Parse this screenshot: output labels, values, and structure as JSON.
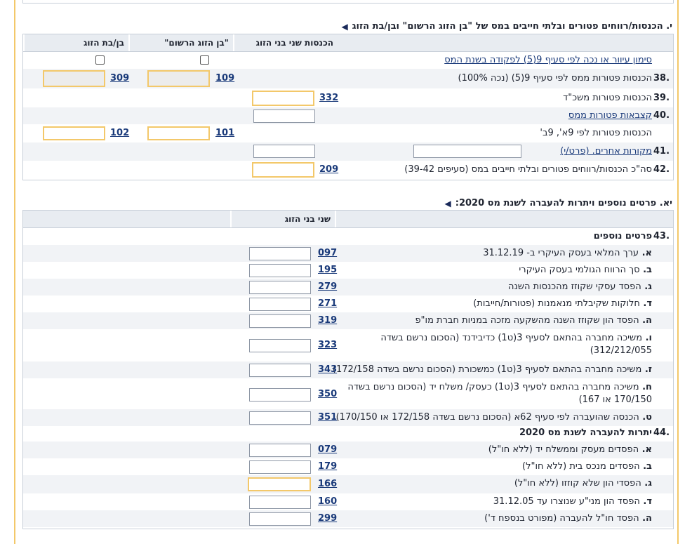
{
  "section10": {
    "title": "י. הכנסות/רווחים פטורים ובלתי חייבים במס של \"בן הזוג הרשום\" ובן/בת הזוג",
    "headers": {
      "both": "הכנסות שני בני הזוג",
      "registered": "\"בן הזוג הרשום\"",
      "spouse": "בן/בת הזוג"
    },
    "mark_row_label": "סימון עיוור או נכה לפי סעיף 9(5) לפקודה בשנת המס",
    "rows": {
      "r38": {
        "num": "38.",
        "label": "הכנסות פטורות ממס לפי סעיף 9(5) (נכה 100%)",
        "code_reg": "109",
        "code_sp": "309"
      },
      "r39": {
        "num": "39.",
        "label": "הכנסות פטורות משכ\"ד",
        "code": "332"
      },
      "r40": {
        "num": "40.",
        "label": "קצבאות פטורות ממס"
      },
      "r40b": {
        "label": "הכנסות פטורות לפי 9א', 9ב'",
        "code_reg": "101",
        "code_sp": "102"
      },
      "r41": {
        "num": "41.",
        "label": "מקורות אחרים. (פרט/י)"
      },
      "r42": {
        "num": "42.",
        "label": "סה\"כ הכנסות/רווחים פטורים ובלתי חייבים במס (סעיפים 39-42)",
        "code": "209"
      }
    }
  },
  "section11": {
    "title": "יא. פרטים נוספים ויתרות להעברה לשנת מס 2020:",
    "header": "שני בני הזוג",
    "r43": {
      "num": "43.",
      "label": "פרטים נוספים"
    },
    "items43": [
      {
        "letter": "א.",
        "label": "ערך המלאי בעסק העיקרי ב- 31.12.19",
        "code": "097"
      },
      {
        "letter": "ב.",
        "label": "סך הרווח הגולמי בעסק העיקרי",
        "code": "195"
      },
      {
        "letter": "ג.",
        "label": "הפסד עסקי שקוזז מהכנסות השנה",
        "code": "279"
      },
      {
        "letter": "ד.",
        "label": "חלוקות שקיבלתי מנאמנות (פטורות/חייבות)",
        "code": "271"
      },
      {
        "letter": "ה.",
        "label": "הפסד הון שקוזז השנה מהשקעה מזכה במניות חברת מו\"פ",
        "code": "319"
      },
      {
        "letter": "ו.",
        "label": "משיכה מחברה בהתאם לסעיף 3(ט1) כדיבידנד (הסכום נרשם בשדה 312/212/055)",
        "code": "323"
      },
      {
        "letter": "ז.",
        "label": "משיכה מחברה בהתאם לסעיף 3(ט1) כמשכורת (הסכום נרשם בשדה 172/158)",
        "code": "343"
      },
      {
        "letter": "ח.",
        "label": "משיכה מחברה בהתאם לסעיף 3(ט1) כעסק/ משלח יד (הסכום נרשם בשדה 170/150 או 167)",
        "code": "350"
      },
      {
        "letter": "ט.",
        "label": "הכנסה שהועברה לפי סעיף 62א (הסכום נרשם בשדה 172/158 או 170/150)",
        "code": "351"
      }
    ],
    "r44": {
      "num": "44.",
      "label": "יתרות להעברה לשנת מס 2020"
    },
    "items44": [
      {
        "letter": "א.",
        "label": "הפסדים מעסק וממשלח יד (ללא חו\"ל)",
        "code": "079"
      },
      {
        "letter": "ב.",
        "label": "הפסדים מנכס בית (ללא חו\"ל)",
        "code": "179"
      },
      {
        "letter": "ג.",
        "label": "הפסדי הון שלא קוזזו (ללא חו\"ל)",
        "code": "166"
      },
      {
        "letter": "ד.",
        "label": "הפסד הון מני\"ע שנוצרו עד 31.12.05",
        "code": "160"
      },
      {
        "letter": "ה.",
        "label": "הפסד חו\"ל להעברה (מפורט בנספח ד')",
        "code": "299"
      }
    ]
  }
}
